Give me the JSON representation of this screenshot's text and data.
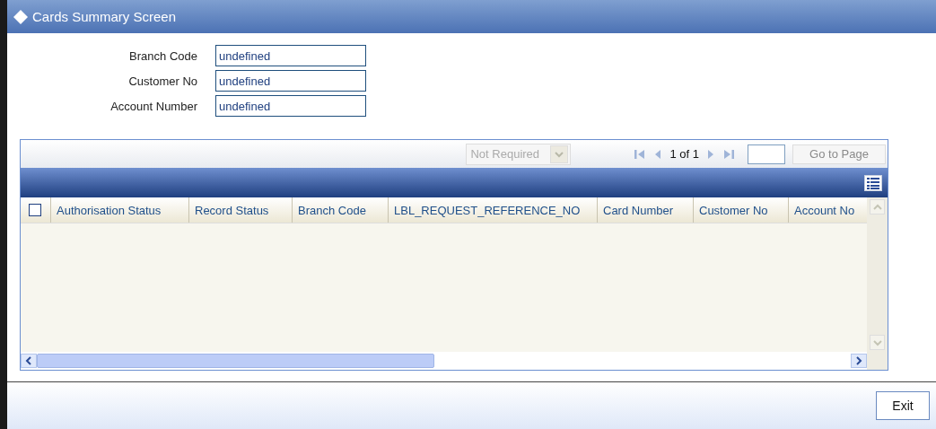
{
  "window": {
    "title": "Cards Summary Screen"
  },
  "fields": [
    {
      "label": "Branch Code",
      "value": "undefined"
    },
    {
      "label": "Customer No",
      "value": "undefined"
    },
    {
      "label": "Account Number",
      "value": "undefined"
    }
  ],
  "grid": {
    "dropdown": {
      "value": "Not Required",
      "disabled": true
    },
    "pager": {
      "text": "1 of 1",
      "go_button": {
        "label": "Go to Page",
        "disabled": true
      }
    },
    "select_all": {
      "checked": false
    },
    "columns": [
      {
        "label": "Authorisation Status"
      },
      {
        "label": "Record Status"
      },
      {
        "label": "Branch Code"
      },
      {
        "label": "LBL_REQUEST_REFERENCE_NO"
      },
      {
        "label": "Card Number"
      },
      {
        "label": "Customer No"
      },
      {
        "label": "Account No"
      }
    ]
  },
  "buttons": [
    {
      "label": "Exit"
    }
  ]
}
